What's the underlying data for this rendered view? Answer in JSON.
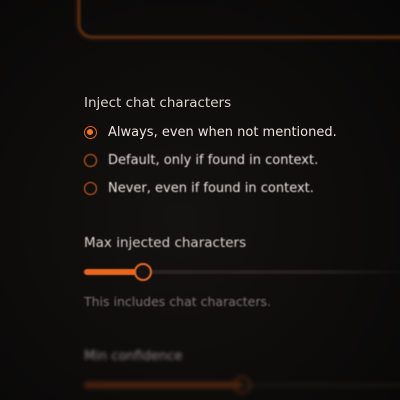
{
  "inject_chat_characters": {
    "label": "Inject chat characters",
    "options": [
      {
        "label": "Always, even when not mentioned.",
        "selected": true
      },
      {
        "label": "Default, only if found in context.",
        "selected": false
      },
      {
        "label": "Never, even if found in context.",
        "selected": false
      }
    ]
  },
  "max_injected_characters": {
    "label": "Max injected characters",
    "value_fraction": 0.18,
    "helper": "This includes chat characters."
  },
  "min_confidence": {
    "label": "Min confidence",
    "value_fraction": 0.48
  },
  "colors": {
    "accent": "#e8661f",
    "background": "#0c0b0a",
    "text": "#e6e1da",
    "muted_text": "#7d7874"
  }
}
